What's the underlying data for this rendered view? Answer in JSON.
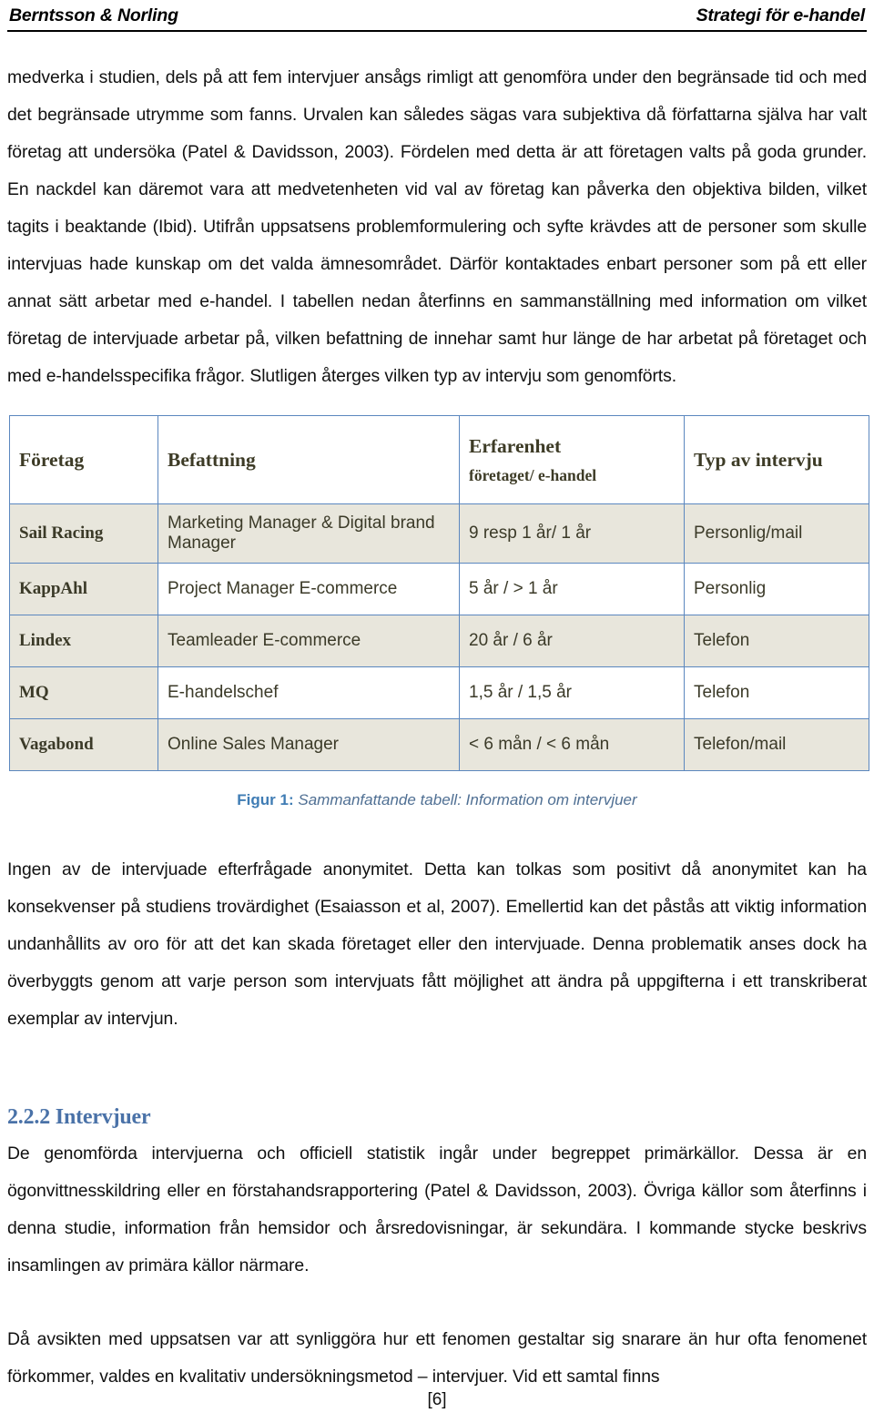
{
  "header": {
    "left": "Berntsson & Norling",
    "right": "Strategi för e-handel"
  },
  "paragraphs": {
    "p1": "medverka i studien, dels på att fem intervjuer ansågs rimligt att genomföra under den begränsade tid och med det begränsade utrymme som fanns. Urvalen kan således sägas vara subjektiva då författarna själva har valt företag att undersöka (Patel & Davidsson, 2003). Fördelen med detta är att företagen valts på goda grunder. En nackdel kan däremot vara att medvetenheten vid val av företag kan påverka den objektiva bilden, vilket tagits i beaktande (Ibid). Utifrån uppsatsens problemformulering och syfte krävdes att de personer som skulle intervjuas hade kunskap om det valda ämnesområdet. Därför kontaktades enbart personer som på ett eller annat sätt arbetar med e-handel. I tabellen nedan återfinns en sammanställning med information om vilket företag de intervjuade arbetar på, vilken befattning de innehar samt hur länge de har arbetat på företaget och med e-handelsspecifika frågor. Slutligen återges vilken typ av intervju som genomförts.",
    "p2": "Ingen av de intervjuade efterfrågade anonymitet. Detta kan tolkas som positivt då anonymitet kan ha konsekvenser på studiens trovärdighet (Esaiasson et al, 2007). Emellertid kan det påstås att viktig information undanhållits av oro för att det kan skada företaget eller den intervjuade. Denna problematik anses dock ha överbyggts genom att varje person som intervjuats fått möjlighet att ändra på uppgifterna i ett transkriberat exemplar av intervjun.",
    "p3": "De genomförda intervjuerna och officiell statistik ingår under begreppet primärkällor. Dessa är en ögonvittnesskildring eller en förstahandsrapportering (Patel & Davidsson, 2003). Övriga källor som återfinns i denna studie, information från hemsidor och årsredovisningar, är sekundära. I kommande stycke beskrivs insamlingen av primära källor närmare.",
    "p4": "Då avsikten med uppsatsen var att synliggöra hur ett fenomen gestaltar sig snarare än hur ofta fenomenet förkommer, valdes en kvalitativ undersökningsmetod – intervjuer. Vid ett samtal finns"
  },
  "table": {
    "headers": {
      "foretag": "Företag",
      "befattning": "Befattning",
      "erfarenhet_main": "Erfarenhet",
      "erfarenhet_sub": "företaget/ e-handel",
      "typ": "Typ av intervju"
    },
    "rows": [
      {
        "company": "Sail Racing",
        "position": "Marketing Manager & Digital brand Manager",
        "experience": "9 resp 1 år/ 1 år",
        "type": "Personlig/mail",
        "shaded": true
      },
      {
        "company": "KappAhl",
        "position": "Project Manager E-commerce",
        "experience": "5 år / > 1 år",
        "type": "Personlig",
        "shaded": false
      },
      {
        "company": "Lindex",
        "position": "Teamleader E-commerce",
        "experience": "20 år / 6 år",
        "type": "Telefon",
        "shaded": true
      },
      {
        "company": "MQ",
        "position": "E-handelschef",
        "experience": "1,5 år / 1,5 år",
        "type": "Telefon",
        "shaded": false
      },
      {
        "company": "Vagabond",
        "position": "Online Sales Manager",
        "experience": "< 6 mån / < 6 mån",
        "type": "Telefon/mail",
        "shaded": true
      }
    ]
  },
  "figure_caption": {
    "label": "Figur 1:",
    "text": "Sammanfattande tabell: Information om intervjuer"
  },
  "section_heading": "2.2.2 Intervjuer",
  "page_number": "[6]",
  "colors": {
    "table_border": "#5b87bf",
    "shaded_cell": "#e8e6dc",
    "heading_blue": "#4a72a8",
    "caption_blue": "#3f7cb4",
    "table_text": "#3b3a28"
  }
}
